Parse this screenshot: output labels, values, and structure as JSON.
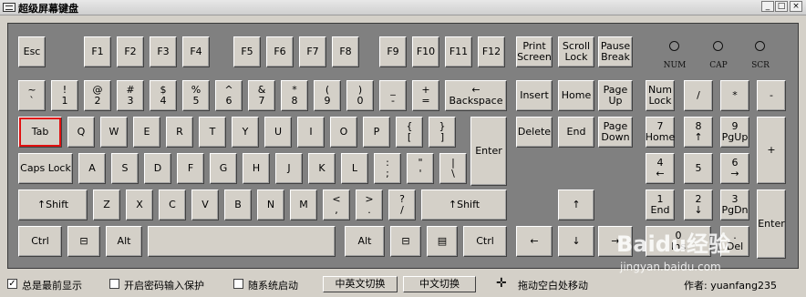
{
  "window": {
    "title": "超级屏幕键盘",
    "minimize": "_",
    "maximize": "□",
    "close": "×"
  },
  "leds": [
    {
      "label": "NUM"
    },
    {
      "label": "CAP"
    },
    {
      "label": "SCR"
    }
  ],
  "keys": {
    "esc": "Esc",
    "f1": "F1",
    "f2": "F2",
    "f3": "F3",
    "f4": "F4",
    "f5": "F5",
    "f6": "F6",
    "f7": "F7",
    "f8": "F8",
    "f9": "F9",
    "f10": "F10",
    "f11": "F11",
    "f12": "F12",
    "printscreen": [
      "Print",
      "Screen"
    ],
    "scrolllock": [
      "Scroll",
      "Lock"
    ],
    "pausebreak": [
      "Pause",
      "Break"
    ],
    "grave": [
      "~",
      "`"
    ],
    "d1": [
      "!",
      "1"
    ],
    "d2": [
      "@",
      "2"
    ],
    "d3": [
      "#",
      "3"
    ],
    "d4": [
      "$",
      "4"
    ],
    "d5": [
      "%",
      "5"
    ],
    "d6": [
      "^",
      "6"
    ],
    "d7": [
      "&",
      "7"
    ],
    "d8": [
      "*",
      "8"
    ],
    "d9": [
      "(",
      "9"
    ],
    "d0": [
      ")",
      "0"
    ],
    "minus": [
      "_",
      "-"
    ],
    "equals": [
      "+",
      "="
    ],
    "backspace": [
      "←",
      "Backspace"
    ],
    "insert": "Insert",
    "home": "Home",
    "pageup": [
      "Page",
      "Up"
    ],
    "numlock": [
      "Num",
      "Lock"
    ],
    "npdiv": "/",
    "npmul": "*",
    "npsub": "-",
    "tab": "Tab",
    "q": "Q",
    "w": "W",
    "e": "E",
    "r": "R",
    "t": "T",
    "y": "Y",
    "u": "U",
    "i": "I",
    "o": "O",
    "p": "P",
    "lbracket": [
      "{",
      "["
    ],
    "rbracket": [
      "}",
      "]"
    ],
    "enter": "Enter",
    "delete": "Delete",
    "end": "End",
    "pagedown": [
      "Page",
      "Down"
    ],
    "np7": [
      "7",
      "Home"
    ],
    "np8": [
      "8",
      "↑"
    ],
    "np9": [
      "9",
      "PgUp"
    ],
    "npadd": "+",
    "capslock": "Caps Lock",
    "a": "A",
    "s": "S",
    "d": "D",
    "f": "F",
    "g": "G",
    "h": "H",
    "j": "J",
    "k": "K",
    "l": "L",
    "semicolon": [
      ":",
      ";"
    ],
    "quote": [
      "\"",
      "'"
    ],
    "backslash": [
      "|",
      "\\"
    ],
    "np4": [
      "4",
      "←"
    ],
    "np5": "5",
    "np6": [
      "6",
      "→"
    ],
    "lshift": "↑Shift",
    "z": "Z",
    "x": "X",
    "c": "C",
    "v": "V",
    "b": "B",
    "n": "N",
    "m": "M",
    "comma": [
      "<",
      ","
    ],
    "period": [
      ">",
      "."
    ],
    "slash": [
      "?",
      "/"
    ],
    "rshift": "↑Shift",
    "up": "↑",
    "np1": [
      "1",
      "End"
    ],
    "np2": [
      "2",
      "↓"
    ],
    "np3": [
      "3",
      "PgDn"
    ],
    "npenter": "Enter",
    "lctrl": "Ctrl",
    "lwin": "⊟",
    "lalt": "Alt",
    "space": "",
    "ralt": "Alt",
    "rwin": "⊟",
    "menu": "▤",
    "rctrl": "Ctrl",
    "left": "←",
    "down": "↓",
    "right": "→",
    "np0": [
      "0",
      "Ins"
    ],
    "npdot": [
      ".",
      "Del"
    ]
  },
  "status": {
    "always_on_top": "总是最前显示",
    "always_on_top_checked": "✓",
    "password_protect": "开启密码输入保护",
    "startup": "随系统启动",
    "btn_cn_en": "中英文切换",
    "btn_cn": "中文切换",
    "move_icon": "✛",
    "move_text": "拖动空白处移动",
    "author": "作者: yuanfang235"
  },
  "watermark": {
    "logo": "Baidu经验",
    "url": "jingyan.baidu.com"
  }
}
